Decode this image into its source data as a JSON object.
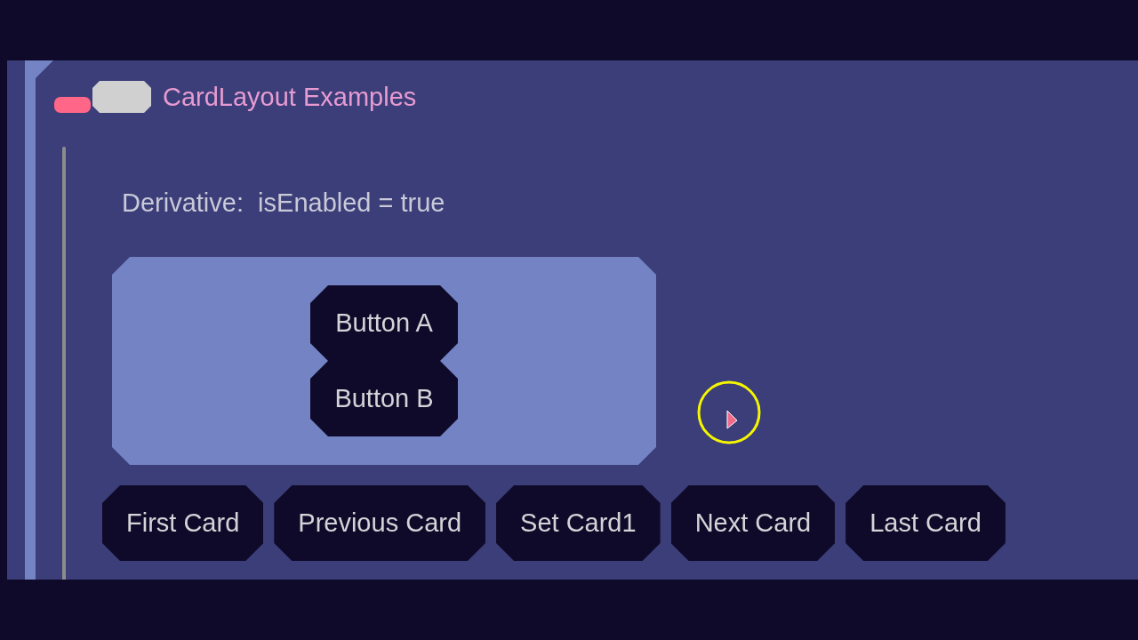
{
  "panel": {
    "title": "CardLayout Examples"
  },
  "status_text": "Derivative:  isEnabled = true",
  "card": {
    "buttons": [
      "Button A",
      "Button B"
    ]
  },
  "nav_buttons": [
    "First Card",
    "Previous Card",
    "Set Card1",
    "Next Card",
    "Last Card"
  ]
}
